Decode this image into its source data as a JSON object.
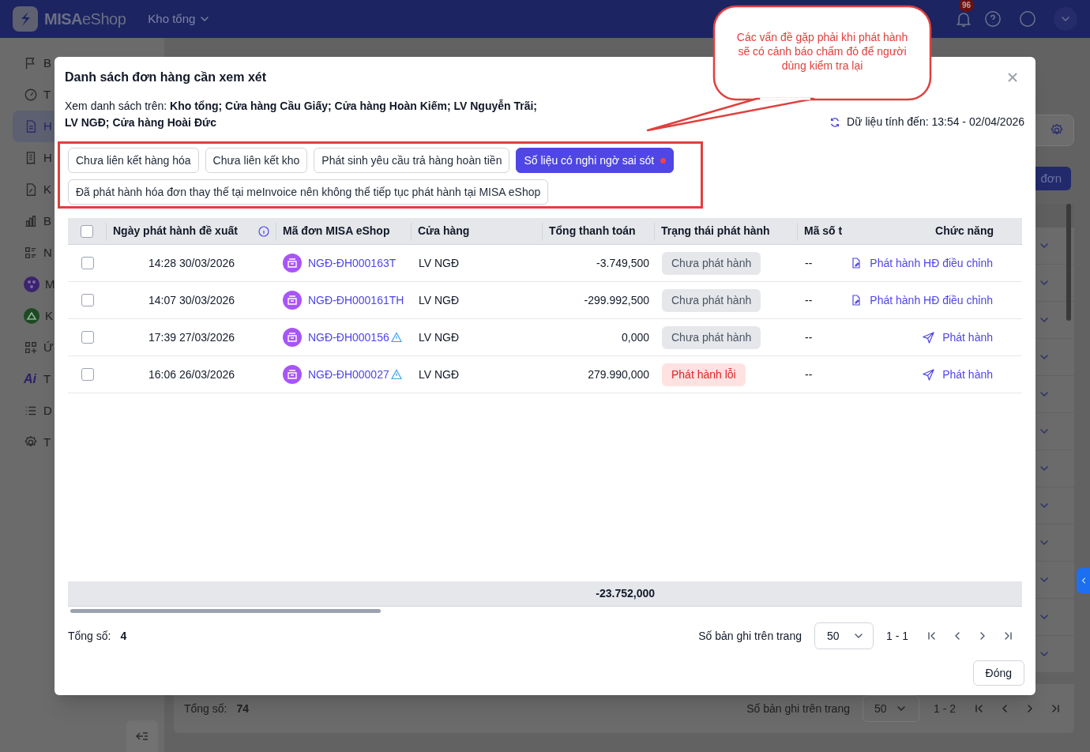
{
  "top_bar": {
    "logo_bold": "MISA",
    "logo_light": "eShop",
    "store": "Kho tổng",
    "notification_count": "96"
  },
  "sidebar": {
    "items": [
      {
        "label": "B",
        "selected": false
      },
      {
        "label": "T",
        "selected": false
      },
      {
        "label": "H",
        "selected": true
      },
      {
        "label": "H",
        "selected": false
      },
      {
        "label": "K",
        "selected": false
      },
      {
        "label": "B",
        "selected": false
      },
      {
        "label": "N",
        "selected": false
      },
      {
        "label": "M",
        "selected": false
      },
      {
        "label": "K",
        "selected": false
      },
      {
        "label": "Ứ",
        "selected": false
      },
      {
        "label": "T",
        "icon_text": "Ai",
        "selected": false
      },
      {
        "label": "D",
        "selected": false
      },
      {
        "label": "T",
        "selected": false
      }
    ]
  },
  "background_page": {
    "new_button": "đơn",
    "total_label": "Tổng số:",
    "total_count": "74",
    "page_size_label": "Số bản ghi trên trang",
    "page_size": "50",
    "range": "1 - 2"
  },
  "callout": {
    "text": "Các vấn đề gặp phải khi phát hành sẽ có cảnh báo chấm đỏ để người dùng kiểm tra lại"
  },
  "modal": {
    "title": "Danh sách đơn hàng cần xem xét",
    "scope": "Xem danh sách trên: **Kho tổng; Cửa hàng Cầu Giấy; Cửa hàng Hoàn Kiếm; LV Nguyễn Trãi; LV NGĐ; Cửa hàng Hoài Đức**",
    "data_time": "Dữ liệu tính đến: 13:54 - 02/04/2026",
    "filters": [
      {
        "label": "Chưa liên kết hàng hóa",
        "selected": false,
        "alert": false
      },
      {
        "label": "Chưa liên kết kho",
        "selected": false,
        "alert": false
      },
      {
        "label": "Phát sinh yêu cầu trả hàng hoàn tiền",
        "selected": false,
        "alert": false
      },
      {
        "label": "Số liệu có nghi ngờ sai sót",
        "selected": true,
        "alert": true
      },
      {
        "label": "Đã phát hành hóa đơn thay thế tại meInvoice nên không thể tiếp tục phát hành tại MISA eShop",
        "selected": false,
        "alert": false
      }
    ],
    "table": {
      "select_all_checked": false,
      "columns": [
        "Ngày phát hành đề xuất",
        "Mã đơn MISA eShop",
        "Cửa hàng",
        "Tổng thanh toán",
        "Trạng thái phát hành",
        "Mã số t",
        "Chức năng"
      ],
      "rows": [
        {
          "checked": false,
          "date": "14:28 30/03/2026",
          "code": "NGĐ-ĐH000163T",
          "code_warning": false,
          "store": "LV NGĐ",
          "total": "-3.749,500",
          "status": {
            "label": "Chưa phát hành",
            "kind": "pending"
          },
          "tax": "--",
          "action": {
            "label": "Phát hành HĐ điều chỉnh",
            "kind": "adjust"
          }
        },
        {
          "checked": false,
          "date": "14:07 30/03/2026",
          "code": "NGĐ-ĐH000161TH",
          "code_warning": false,
          "store": "LV NGĐ",
          "total": "-299.992,500",
          "status": {
            "label": "Chưa phát hành",
            "kind": "pending"
          },
          "tax": "--",
          "action": {
            "label": "Phát hành HĐ điều chỉnh",
            "kind": "adjust"
          }
        },
        {
          "checked": false,
          "date": "17:39 27/03/2026",
          "code": "NGĐ-ĐH000156",
          "code_warning": true,
          "store": "LV NGĐ",
          "total": "0,000",
          "status": {
            "label": "Chưa phát hành",
            "kind": "pending"
          },
          "tax": "--",
          "action": {
            "label": "Phát hành",
            "kind": "issue"
          }
        },
        {
          "checked": false,
          "date": "16:06 26/03/2026",
          "code": "NGĐ-ĐH000027",
          "code_warning": true,
          "store": "LV NGĐ",
          "total": "279.990,000",
          "status": {
            "label": "Phát hành lỗi",
            "kind": "error"
          },
          "tax": "--",
          "action": {
            "label": "Phát hành",
            "kind": "issue"
          }
        }
      ],
      "summary_total": "-23.752,000"
    },
    "total_label": "Tổng số:",
    "total_count": "4",
    "page_size_label": "Số bản ghi trên trang",
    "page_size": "50",
    "range": "1 - 1",
    "close_button": "Đóng"
  }
}
